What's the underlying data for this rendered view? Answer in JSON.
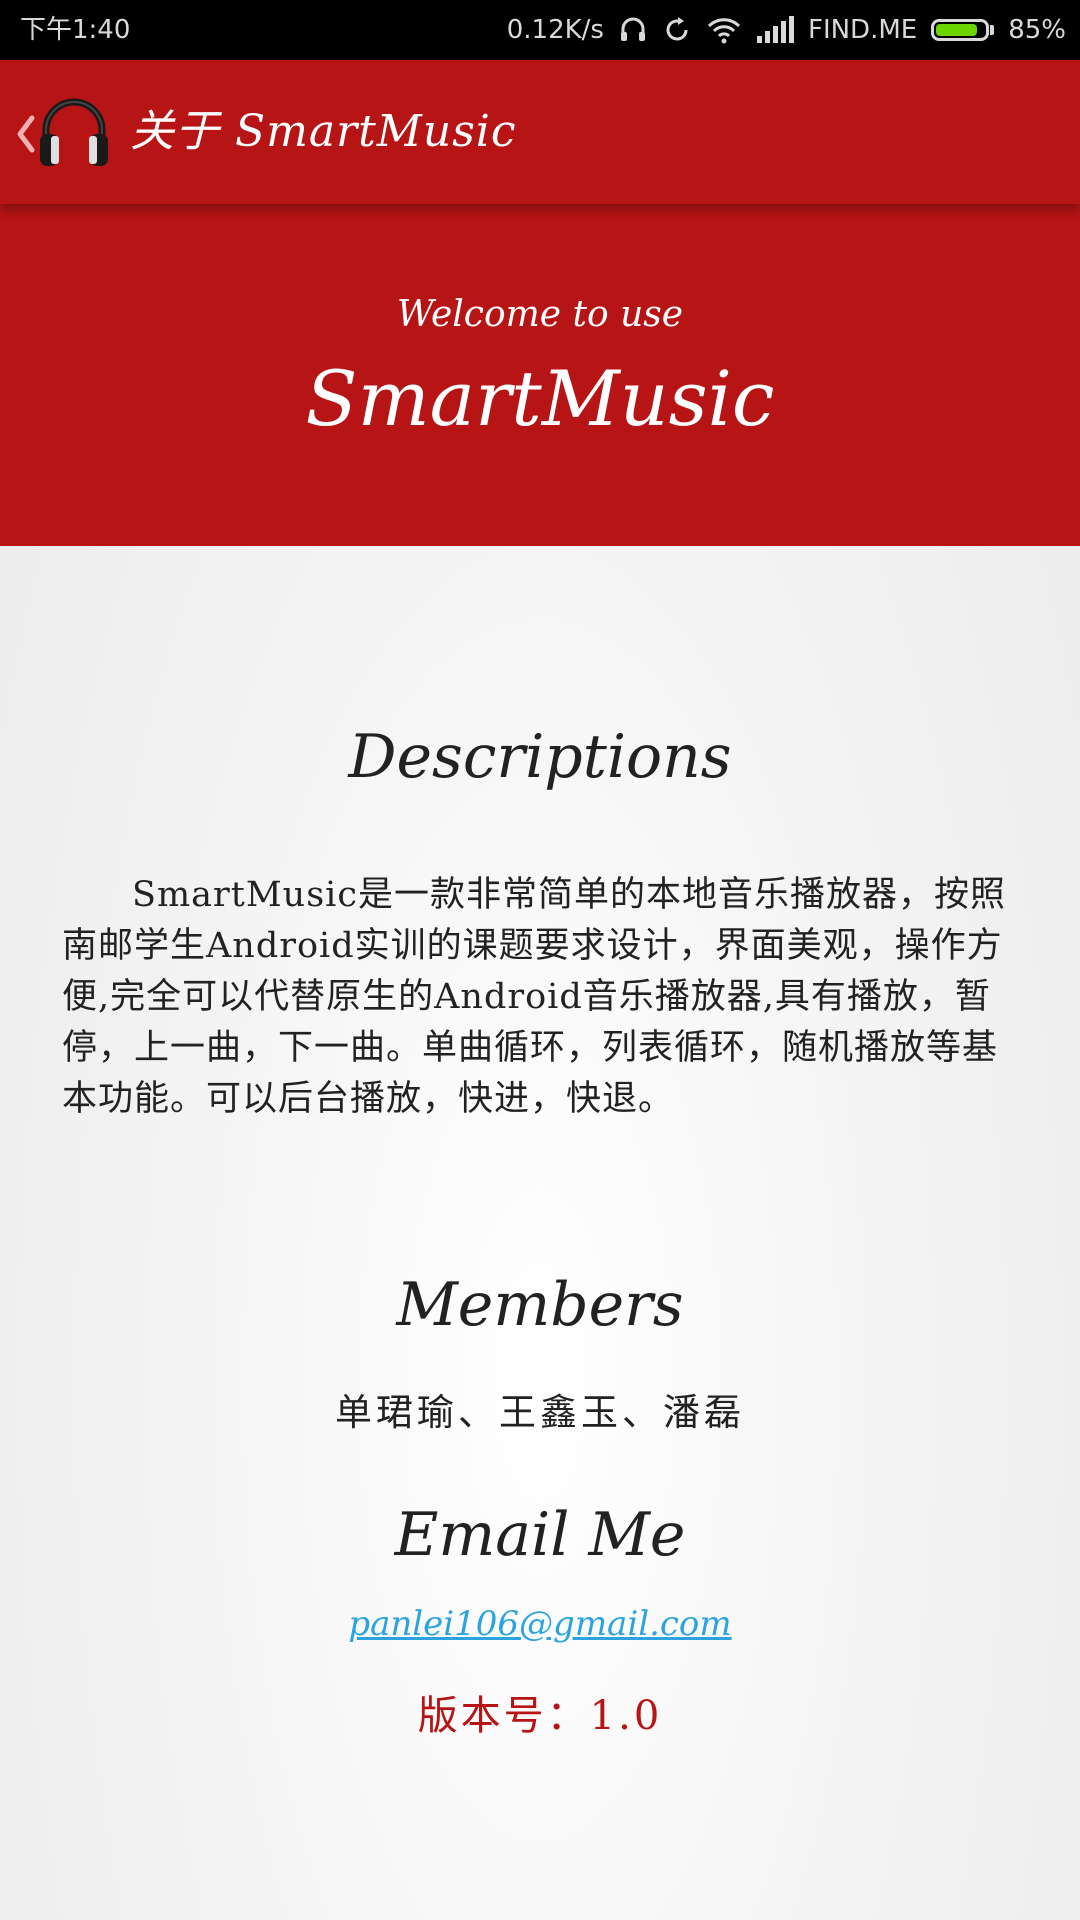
{
  "status_bar": {
    "time": "下午1:40",
    "network_speed": "0.12K/s",
    "carrier": "FIND.ME",
    "battery_percent": "85%",
    "battery_level": 0.85,
    "icons": [
      "headset-icon",
      "sync-icon",
      "wifi-icon",
      "signal-icon",
      "battery-icon"
    ]
  },
  "app_bar": {
    "title": "关于 SmartMusic",
    "logo_icon": "headphones-icon",
    "back_icon": "chevron-left-icon"
  },
  "hero": {
    "subtitle": "Welcome to use",
    "title": "SmartMusic"
  },
  "descriptions": {
    "heading": "Descriptions",
    "body": "SmartMusic是一款非常简单的本地音乐播放器，按照南邮学生Android实训的课题要求设计，界面美观，操作方便,完全可以代替原生的Android音乐播放器,具有播放，暂停，上一曲，下一曲。单曲循环，列表循环，随机播放等基本功能。可以后台播放，快进，快退。"
  },
  "members": {
    "heading": "Members",
    "names": "单珺瑜、王鑫玉、潘磊"
  },
  "email": {
    "heading": "Email Me",
    "address": "panlei106@gmail.com"
  },
  "version": {
    "text": "版本号：1.0"
  },
  "colors": {
    "primary": "#b71416",
    "link": "#2aa3e0",
    "battery": "#6bd600"
  }
}
